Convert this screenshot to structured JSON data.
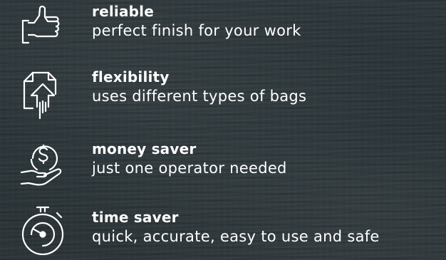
{
  "features": [
    {
      "icon": "thumbs-up-icon",
      "title": "reliable",
      "description": "perfect finish for your work"
    },
    {
      "icon": "document-upload-icon",
      "title": "flexibility",
      "description": "uses different types of bags"
    },
    {
      "icon": "money-hand-icon",
      "title": "money saver",
      "description": "just one operator needed"
    },
    {
      "icon": "stopwatch-icon",
      "title": "time saver",
      "description": "quick, accurate, easy to use and safe"
    }
  ],
  "colors": {
    "background": "#2b3337",
    "text": "#ffffff"
  }
}
